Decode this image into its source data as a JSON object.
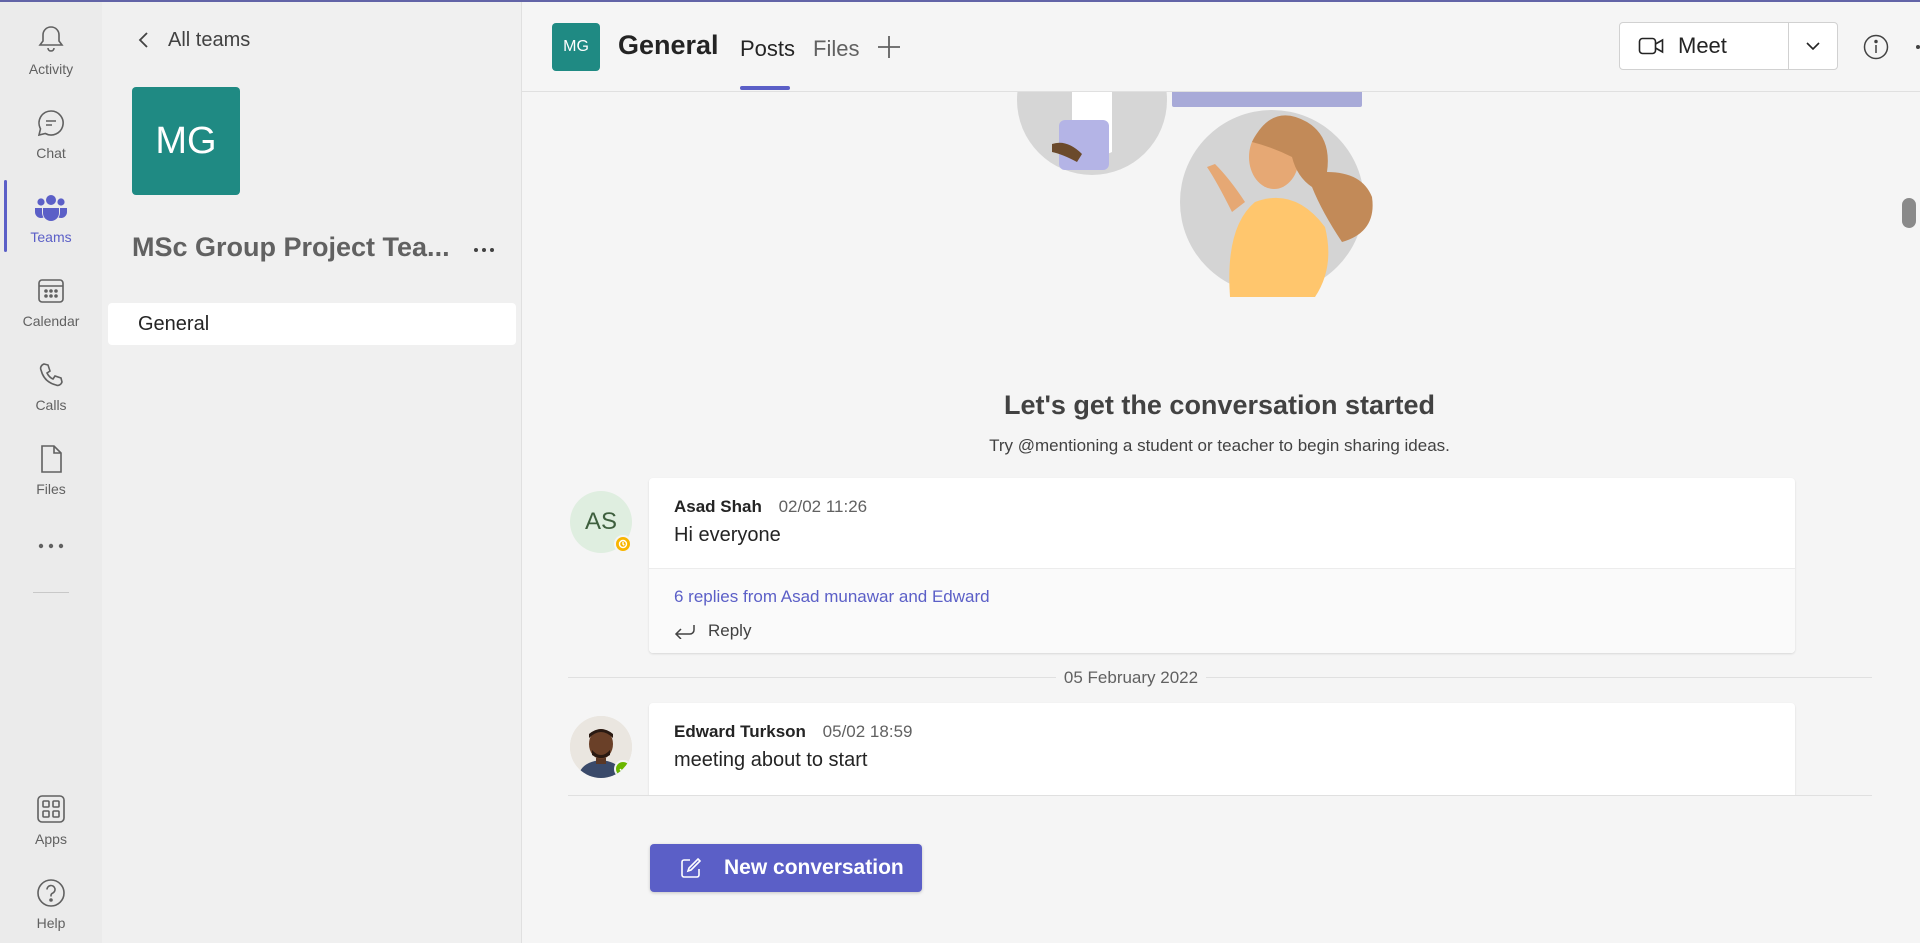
{
  "colors": {
    "brand": "#5b5fc7",
    "team_teal": "#1f8a83",
    "away": "#f8b500",
    "available": "#6bb700"
  },
  "rail": {
    "items": [
      {
        "label": "Activity",
        "icon": "bell-icon"
      },
      {
        "label": "Chat",
        "icon": "chat-icon"
      },
      {
        "label": "Teams",
        "icon": "teams-icon"
      },
      {
        "label": "Calendar",
        "icon": "calendar-icon"
      },
      {
        "label": "Calls",
        "icon": "phone-icon"
      },
      {
        "label": "Files",
        "icon": "file-icon"
      }
    ],
    "more": "more-apps-icon",
    "bottom": [
      {
        "label": "Apps",
        "icon": "apps-icon"
      },
      {
        "label": "Help",
        "icon": "help-icon"
      }
    ]
  },
  "panel": {
    "back_label": "All teams",
    "team_initials": "MG",
    "team_name": "MSc Group Project Tea...",
    "channels": [
      {
        "label": "General"
      }
    ]
  },
  "header": {
    "initials": "MG",
    "channel_name": "General",
    "tabs": [
      {
        "label": "Posts"
      },
      {
        "label": "Files"
      }
    ],
    "meet_label": "Meet"
  },
  "welcome": {
    "title": "Let's get the conversation started",
    "subtitle": "Try @mentioning a student or teacher to begin sharing ideas."
  },
  "messages": [
    {
      "author": "Asad Shah",
      "time": "02/02 11:26",
      "text": "Hi everyone",
      "initials": "AS",
      "replies": "6 replies from Asad munawar and Edward",
      "reply_label": "Reply"
    },
    {
      "author": "Edward Turkson",
      "time": "05/02 18:59",
      "text": "meeting about to start"
    }
  ],
  "date_divider": "05 February 2022",
  "new_conversation_label": "New conversation"
}
